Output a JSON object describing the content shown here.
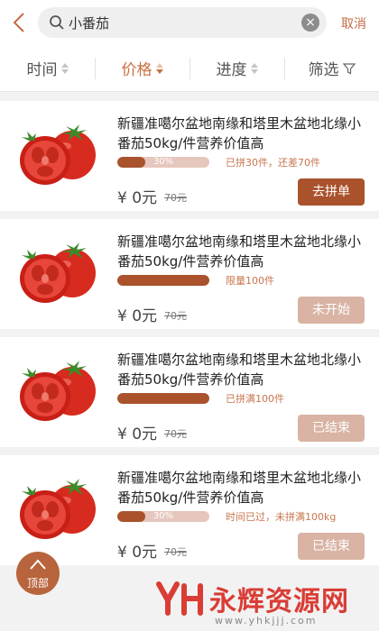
{
  "search": {
    "query": "小番茄",
    "cancel_label": "取消"
  },
  "filters": [
    {
      "label": "时间",
      "active": false
    },
    {
      "label": "价格",
      "active": true
    },
    {
      "label": "进度",
      "active": false
    },
    {
      "label": "筛选",
      "active": false
    }
  ],
  "products": [
    {
      "title": "新疆准噶尔盆地南缘和塔里木盆地北缘小番茄50kg/件营养价值高",
      "progress": 0.3,
      "progress_label": "30%",
      "status_text": "已拼30件，还差70件",
      "price": "¥ 0元",
      "original_price": "70元",
      "action": "去拼单"
    },
    {
      "title": "新疆准噶尔盆地南缘和塔里木盆地北缘小番茄50kg/件营养价值高",
      "progress": 1.0,
      "progress_label": "",
      "status_text": "限量100件",
      "price": "¥ 0元",
      "original_price": "70元",
      "action": "未开始"
    },
    {
      "title": "新疆准噶尔盆地南缘和塔里木盆地北缘小番茄50kg/件营养价值高",
      "progress": 1.0,
      "progress_label": "",
      "status_text": "已拼满100件",
      "price": "¥ 0元",
      "original_price": "70元",
      "action": "已结束"
    },
    {
      "title": "新疆准噶尔盆地南缘和塔里木盆地北缘小番茄50kg/件营养价值高",
      "progress": 0.3,
      "progress_label": "30%",
      "status_text": "时间已过，未拼满100kg",
      "price": "¥ 0元",
      "original_price": "70元",
      "action": "已结束"
    }
  ],
  "back_to_top_label": "顶部",
  "watermark": {
    "name": "永辉资源网",
    "url": "www.yhkjjj.com"
  },
  "colors": {
    "accent": "#c9703f",
    "primary_button": "#a9522c",
    "muted_button": "#d9b3a3",
    "watermark": "#d93d35"
  }
}
